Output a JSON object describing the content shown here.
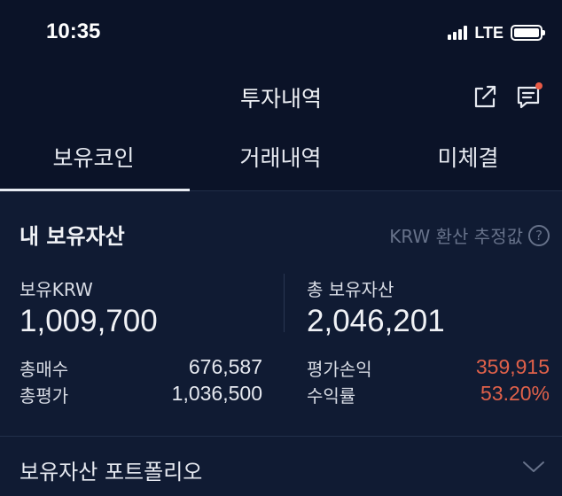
{
  "status": {
    "time": "10:35",
    "network": "LTE"
  },
  "header": {
    "title": "투자내역"
  },
  "tabs": [
    {
      "label": "보유코인",
      "active": true
    },
    {
      "label": "거래내역",
      "active": false
    },
    {
      "label": "미체결",
      "active": false
    }
  ],
  "holdings": {
    "title": "내 보유자산",
    "krw_estimate_label": "KRW 환산 추정값",
    "krw_label": "보유KRW",
    "krw_value": "1,009,700",
    "total_label": "총 보유자산",
    "total_value": "2,046,201",
    "buy_label": "총매수",
    "buy_value": "676,587",
    "eval_label": "총평가",
    "eval_value": "1,036,500",
    "pnl_label": "평가손익",
    "pnl_value": "359,915",
    "return_label": "수익률",
    "return_value": "53.20%"
  },
  "portfolio": {
    "title": "보유자산 포트폴리오"
  },
  "colors": {
    "background": "#0e1830",
    "accent_red": "#e0614a",
    "muted": "#67728a"
  },
  "icons": [
    "signal-icon",
    "battery-icon",
    "share-icon",
    "chat-icon",
    "help-icon",
    "chevron-down-icon"
  ]
}
